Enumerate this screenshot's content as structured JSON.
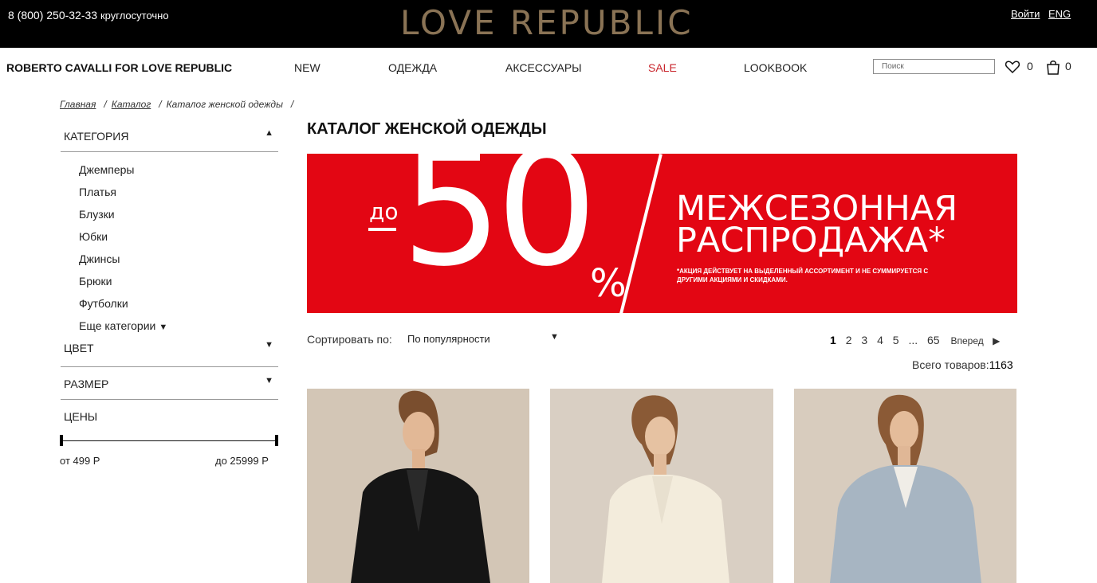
{
  "topbar": {
    "phone": "8 (800) 250-32-33",
    "phone_note": "круглосуточно",
    "logo": "LOVE REPUBLIC",
    "login": "Войти",
    "lang": "ENG"
  },
  "nav": {
    "brandline": "ROBERTO CAVALLI FOR LOVE REPUBLIC",
    "items": [
      "NEW",
      "ОДЕЖДА",
      "АКСЕССУАРЫ",
      "SALE",
      "LOOKBOOK"
    ],
    "search_placeholder": "Поиск",
    "wishlist_count": "0",
    "cart_count": "0"
  },
  "breadcrumbs": [
    "Главная",
    "Каталог",
    "Каталог женской одежды"
  ],
  "sidebar": {
    "category_title": "КАТЕГОРИЯ",
    "categories": [
      "Джемперы",
      "Платья",
      "Блузки",
      "Юбки",
      "Джинсы",
      "Брюки",
      "Футболки",
      "Еще категории"
    ],
    "color_title": "ЦВЕТ",
    "size_title": "РАЗМЕР",
    "price_title": "ЦЕНЫ",
    "price_from": "от 499 Р",
    "price_to": "до 25999 Р"
  },
  "main": {
    "title": "КАТАЛОГ ЖЕНСКОЙ ОДЕЖДЫ",
    "banner": {
      "prefix": "до",
      "discount": "50",
      "percent": "%",
      "headline1": "МЕЖСЕЗОННАЯ",
      "headline2": "РАСПРОДАЖА*",
      "note": "*АКЦИЯ ДЕЙСТВУЕТ НА ВЫДЕЛЕННЫЙ АССОРТИМЕНТ И НЕ СУММИРУЕТСЯ С ДРУГИМИ АКЦИЯМИ И СКИДКАМИ."
    },
    "sort_label": "Сортировать по:",
    "sort_value": "По популярности",
    "pager": {
      "pages": [
        "1",
        "2",
        "3",
        "4",
        "5",
        "...",
        "65"
      ],
      "current": "1",
      "next": "Вперед"
    },
    "total_label": "Всего товаров:",
    "total_value": "1163"
  },
  "colors": {
    "accent_red": "#e30613",
    "sale_red": "#c8242b",
    "logo_gold": "#8a7355"
  }
}
